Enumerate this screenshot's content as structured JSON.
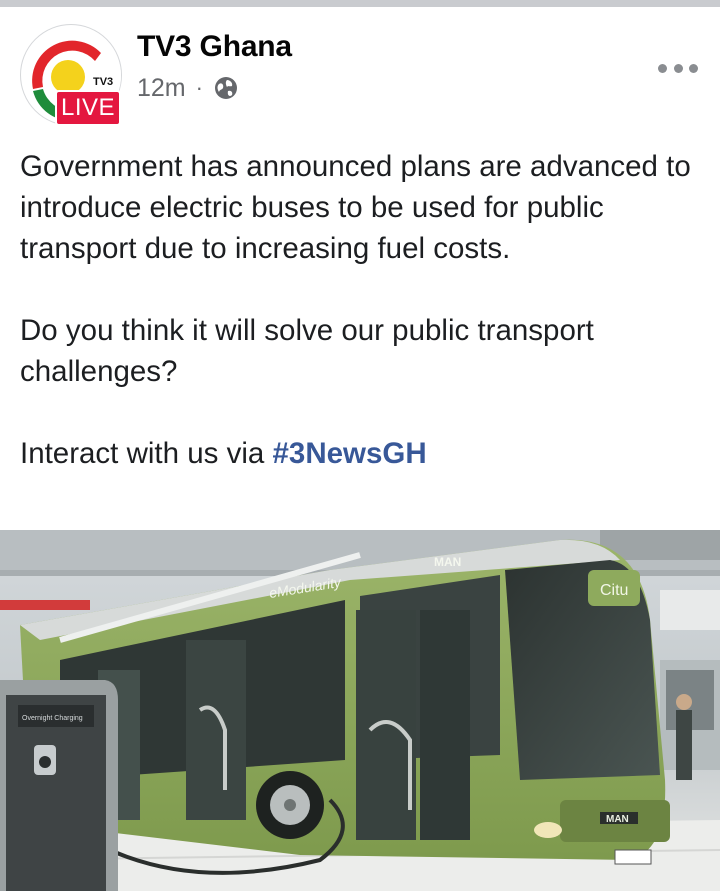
{
  "post": {
    "page_name": "TV3 Ghana",
    "avatar_logo_text": "TV3",
    "live_badge": "LIVE",
    "timestamp": "12m",
    "separator": "·",
    "privacy_icon": "globe-icon",
    "more_icon": "more-options-icon",
    "paragraph1": "Government has announced plans are advanced to introduce electric buses to be used for public transport due to increasing fuel costs.",
    "paragraph2": "Do you think it will solve our public transport challenges?",
    "paragraph3_prefix": "Interact with us via ",
    "hashtag": "#3NewsGH",
    "photo": {
      "bus_brand": "MAN",
      "bus_model": "Citu",
      "bus_slogan": "eModularity",
      "charger_label": "Overnight Charging"
    }
  },
  "colors": {
    "live_red": "#e4173f",
    "hashtag_blue": "#385898",
    "bus_green": "#8aa55a",
    "meta_gray": "#65676b"
  }
}
